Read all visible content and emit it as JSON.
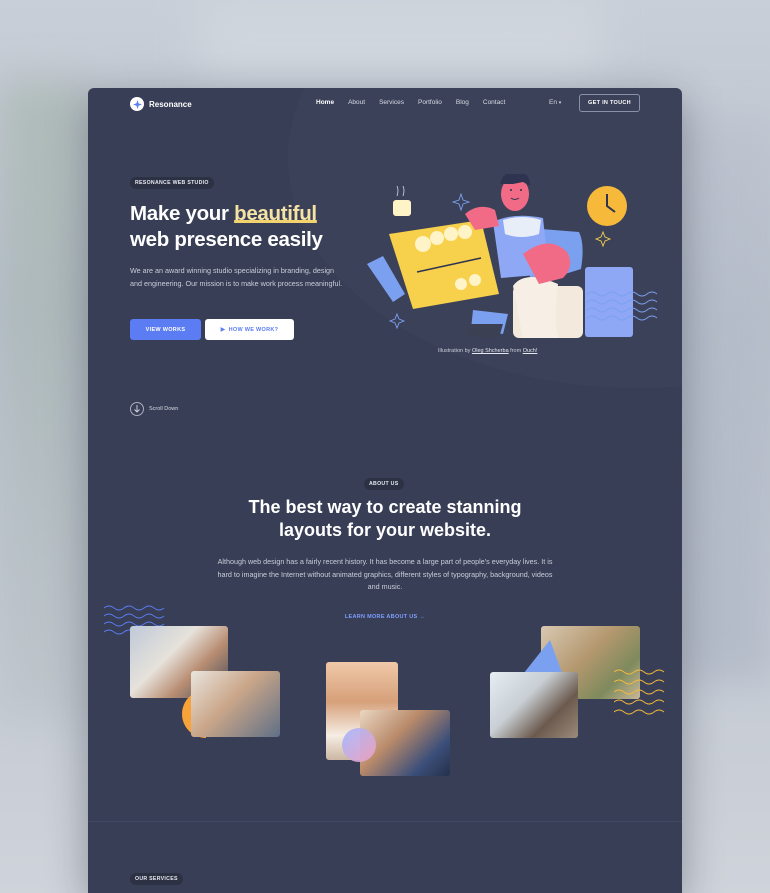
{
  "brand": {
    "name": "Resonance"
  },
  "nav": {
    "items": [
      "Home",
      "About",
      "Services",
      "Portfolio",
      "Blog",
      "Contact"
    ],
    "active": "Home",
    "language": "En",
    "cta": "GET IN TOUCH"
  },
  "hero": {
    "badge": "RESONANCE WEB STUDIO",
    "title_part1": "Make your",
    "title_highlight": "beautiful",
    "title_part2": "web presence easily",
    "description": "We are an award winning studio specializing in branding, design and engineering. Our mission is to make work process meaningful.",
    "primary_button": "VIEW WORKS",
    "secondary_button": "HOW WE WORK?",
    "credit_prefix": "Illustration by",
    "credit_author": "Oleg Shcherba",
    "credit_middle": "from",
    "credit_source": "Ouch!",
    "scroll_label": "Scroll Down"
  },
  "about": {
    "badge": "ABOUT US",
    "title_line1": "The best way to create stanning",
    "title_line2": "layouts for your website.",
    "description": "Although web design has a fairly recent history. It has become a large part of people's everyday lives. It is hard to imagine the Internet without animated graphics, different styles of typography, background, videos and music.",
    "link": "LEARN MORE ABOUT US"
  },
  "services": {
    "badge": "OUR SERVICES"
  },
  "colors": {
    "background": "#383e55",
    "accent": "#5b7cf2",
    "highlight": "#f5e2a5",
    "link": "#7f9dff"
  }
}
